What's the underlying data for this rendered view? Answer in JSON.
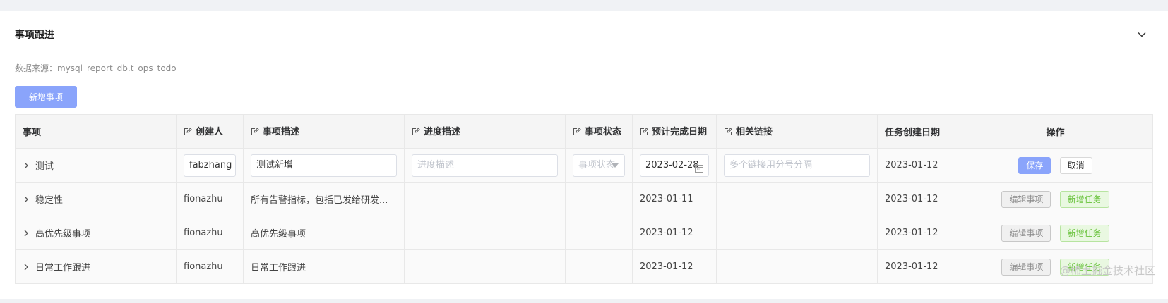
{
  "card": {
    "title": "事项跟进",
    "source": "数据来源：mysql_report_db.t_ops_todo",
    "add_button": "新增事项"
  },
  "table": {
    "headers": {
      "item": "事项",
      "creator": "创建人",
      "desc": "事项描述",
      "progress": "进度描述",
      "status": "事项状态",
      "due": "预计完成日期",
      "links": "相关链接",
      "created": "任务创建日期",
      "ops": "操作"
    },
    "edit_row": {
      "item": "测试",
      "creator_value": "fabzhang",
      "desc_value": "测试新增",
      "progress_placeholder": "进度描述",
      "status_placeholder": "事项状态",
      "due_value": "2023-02-28",
      "links_placeholder": "多个链接用分号分隔",
      "created": "2023-01-12",
      "save_label": "保存",
      "cancel_label": "取消"
    },
    "rows": [
      {
        "item": "稳定性",
        "creator": "fionazhu",
        "desc": "所有告警指标，包括已发给研发...",
        "progress": "",
        "status": "",
        "due": "2023-01-11",
        "links": "",
        "created": "2023-01-12",
        "edit_label": "编辑事项",
        "add_task_label": "新增任务"
      },
      {
        "item": "高优先级事项",
        "creator": "fionazhu",
        "desc": "高优先级事项",
        "progress": "",
        "status": "",
        "due": "2023-01-12",
        "links": "",
        "created": "2023-01-12",
        "edit_label": "编辑事项",
        "add_task_label": "新增任务"
      },
      {
        "item": "日常工作跟进",
        "creator": "fionazhu",
        "desc": "日常工作跟进",
        "progress": "",
        "status": "",
        "due": "2023-01-12",
        "links": "",
        "created": "2023-01-12",
        "edit_label": "编辑事项",
        "add_task_label": "新增任务"
      }
    ]
  },
  "watermark": "@稀土掘金技术社区",
  "colors": {
    "primary": "#8aa4fb",
    "success_text": "#67c23a",
    "success_bg": "#e9f8e1"
  }
}
